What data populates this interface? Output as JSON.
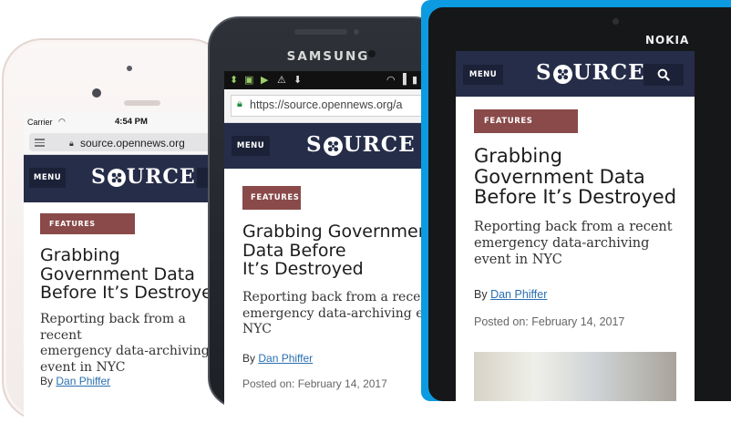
{
  "site": {
    "menu_label": "MENU",
    "logo_text": "SOURCE",
    "article": {
      "badge": "FEATURES",
      "headline_lines_iphone": [
        "Grabbing",
        "Government Data",
        "Before It’s Destroyed"
      ],
      "headline_lines_samsung": [
        "Grabbing Government",
        "Data Before",
        "It’s Destroyed"
      ],
      "headline_lines_nokia": [
        "Grabbing",
        "Government Data",
        "Before It’s Destroyed"
      ],
      "dek_lines_iphone": [
        "Reporting back from a recent",
        "emergency data-archiving",
        "event in NYC"
      ],
      "dek_lines_samsung": [
        "Reporting back from a recent",
        "emergency data-archiving event in",
        "NYC"
      ],
      "dek_lines_nokia": [
        "Reporting back from a recent",
        "emergency data-archiving",
        "event in NYC"
      ],
      "by_prefix": "By",
      "author": "Dan Phiffer",
      "posted_on": "Posted on: February 14, 2017"
    }
  },
  "iphone": {
    "carrier": "Carrier",
    "time": "4:54 PM",
    "url": "source.opennews.org"
  },
  "samsung": {
    "brand": "SAMSUNG",
    "url": "https://source.opennews.org/a"
  },
  "nokia": {
    "brand": "NOKIA"
  },
  "colors": {
    "header_navy": "#262d49",
    "badge_maroon": "#8a4a4a",
    "link_blue": "#2a6fb0",
    "nokia_blue": "#0c9be0"
  }
}
